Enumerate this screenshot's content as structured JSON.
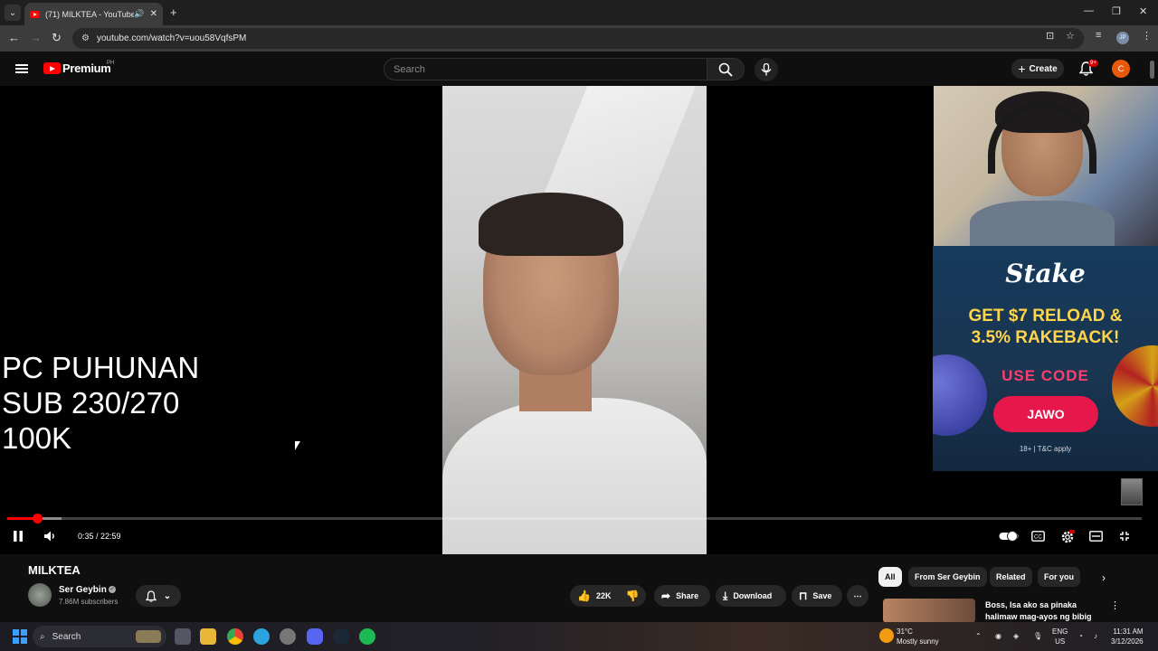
{
  "browser": {
    "tab_title": "(71) MILKTEA - YouTube",
    "url": "youtube.com/watch?v=uou58VqfsPM",
    "profile_initials": "JP"
  },
  "masthead": {
    "brand": "Premium",
    "region": "PH",
    "search_placeholder": "Search",
    "create_label": "Create",
    "notifications_badge": "9+",
    "avatar_letter": "C"
  },
  "player": {
    "overlay_lines": "PC PUHUNAN\nSUB 230/270\n100K",
    "time_display": "0:35 / 22:59",
    "progress_played_fraction": 0.026,
    "progress_buffered_fraction": 0.048
  },
  "ad": {
    "logo": "Stake",
    "headline_line1": "GET $7 RELOAD &",
    "headline_line2": "3.5% RAKEBACK!",
    "code_label": "USE CODE",
    "cta": "JAWO",
    "legal": "18+ | T&C apply"
  },
  "video": {
    "title": "MILKTEA",
    "channel_name": "Ser Geybin",
    "subscribers": "7.86M subscribers",
    "likes": "22K",
    "share_label": "Share",
    "download_label": "Download",
    "save_label": "Save"
  },
  "chips": [
    "All",
    "From Ser Geybin",
    "Related",
    "For you"
  ],
  "recommendation": {
    "title": "Boss, Isa ako sa pinaka halimaw mag-ayos ng bibig"
  },
  "taskbar": {
    "search_label": "Search",
    "weather_temp": "31°C",
    "weather_desc": "Mostly sunny",
    "lang_line1": "ENG",
    "lang_line2": "US",
    "time": "11:31 AM",
    "date": "3/12/2026"
  },
  "colors": {
    "youtube_red": "#ff0000",
    "ad_cta": "#e6184b",
    "ad_headline": "#ffd54a"
  }
}
